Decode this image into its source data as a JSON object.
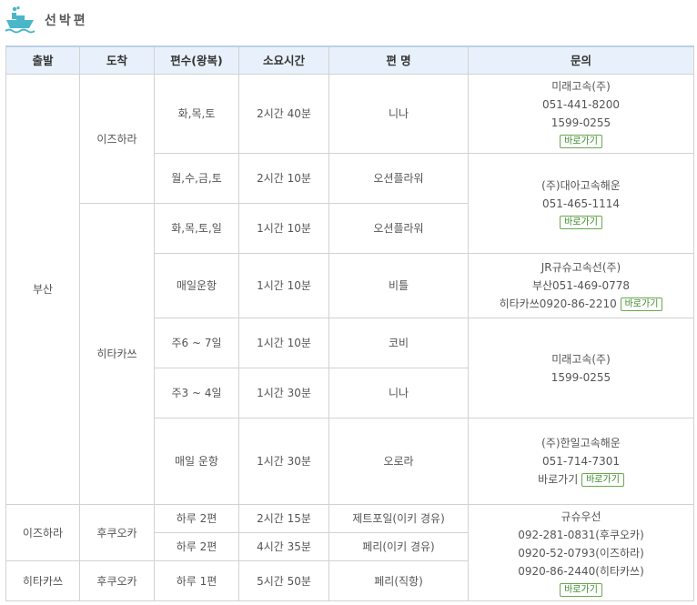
{
  "section": {
    "title": "선박편",
    "icon": "ship-icon",
    "icon_color": "#4bb6c9"
  },
  "headers": [
    "출발",
    "도착",
    "편수(왕복)",
    "소요시간",
    "편 명",
    "문의"
  ],
  "button_label": "바로가기",
  "departures": [
    "부산",
    "이즈하라",
    "히타카쓰"
  ],
  "arrivals": [
    "이즈하라",
    "히타카쓰",
    "후쿠오카",
    "후쿠오카"
  ],
  "rows": [
    {
      "freq": "화,목,토",
      "time": "2시간 40분",
      "name": "니나"
    },
    {
      "freq": "월,수,금,토",
      "time": "2시간 10분",
      "name": "오션플라워"
    },
    {
      "freq": "화,목,토,일",
      "time": "1시간 10분",
      "name": "오션플라워"
    },
    {
      "freq": "매일운항",
      "time": "1시간 10분",
      "name": "비틀"
    },
    {
      "freq": "주6 ~ 7일",
      "time": "1시간 10분",
      "name": "코비"
    },
    {
      "freq": "주3 ~ 4일",
      "time": "1시간 30분",
      "name": "니나"
    },
    {
      "freq": "매일 운항",
      "time": "1시간 30분",
      "name": "오로라"
    },
    {
      "freq": "하루 2편",
      "time": "2시간 15분",
      "name": "제트포일(이키 경유)"
    },
    {
      "freq": "하루 2편",
      "time": "4시간 35분",
      "name": "페리(이키 경유)"
    },
    {
      "freq": "하루 1편",
      "time": "5시간 50분",
      "name": "페리(직항)"
    }
  ],
  "contacts": [
    {
      "lines": [
        "미래고속(주)",
        "051-441-8200",
        "1599-0255"
      ]
    },
    {
      "lines": [
        "(주)대아고속해운",
        "051-465-1114"
      ]
    },
    {
      "lines": [
        "JR규슈고속선(주)",
        "부산051-469-0778",
        "히타카쓰0920-86-2210"
      ]
    },
    {
      "lines": [
        "미래고속(주)",
        "1599-0255"
      ]
    },
    {
      "lines": [
        "(주)한일고속해운",
        "051-714-7301",
        "바로가기"
      ]
    },
    {
      "lines": [
        "규슈우선",
        "092-281-0831(후쿠오카)",
        "0920-52-0793(이즈하라)",
        "0920-86-2440(히타카쓰)"
      ]
    }
  ]
}
